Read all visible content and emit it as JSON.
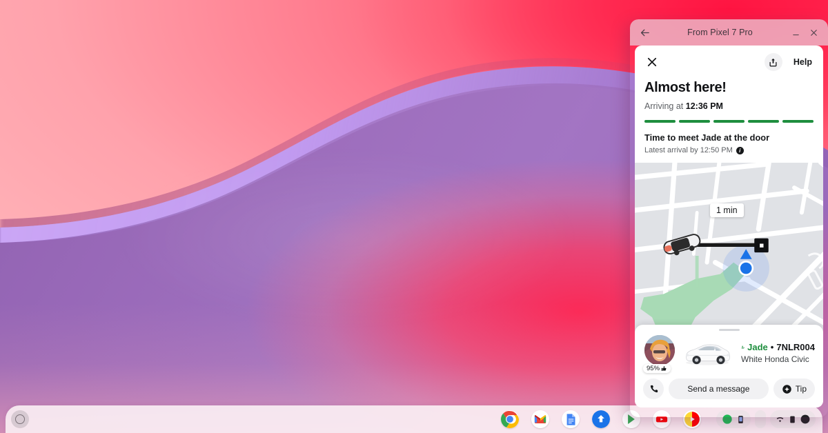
{
  "desktop": {
    "wallpaper_colors": {
      "pink_light": "#ffa9b2",
      "pink_hot": "#ff2b52",
      "purple": "#a277c9",
      "lilac": "#cdaaf8"
    },
    "shelf": {
      "launcher_name": "launcher-button",
      "apps": [
        {
          "name": "chrome",
          "label": "Chrome"
        },
        {
          "name": "gmail",
          "label": "Gmail"
        },
        {
          "name": "docs",
          "label": "Docs"
        },
        {
          "name": "files",
          "label": "Files"
        },
        {
          "name": "play-store",
          "label": "Play Store"
        },
        {
          "name": "youtube",
          "label": "YouTube"
        },
        {
          "name": "youtube-music",
          "label": "YouTube Music"
        }
      ],
      "status": {
        "time": "",
        "battery": ""
      }
    }
  },
  "window": {
    "title": "From Pixel 7 Pro",
    "back_icon": "back-arrow-icon",
    "minimize_icon": "minimize-icon",
    "close_icon": "close-icon"
  },
  "app": {
    "close_icon": "close-icon",
    "share_icon": "share-icon",
    "help_label": "Help",
    "headline": "Almost here!",
    "arriving_prefix": "Arriving at ",
    "arriving_time": "12:36 PM",
    "progress": {
      "segments": 5,
      "filled": 5,
      "color": "#1e8e3e",
      "empty_color": "#dadce0"
    },
    "meet_text": "Time to meet Jade at the door",
    "latest_arrival": "Latest arrival by 12:50 PM",
    "info_icon": "info-icon",
    "map": {
      "eta_chip": "1 min",
      "vehicle_icon": "car-marker-icon",
      "destination_icon": "destination-marker-icon",
      "user_location_icon": "user-location-dot-icon",
      "road_color": "#ffffff",
      "block_color": "#e0e2e6",
      "park_color": "#a8dab5",
      "route_color": "#1a1a1a"
    },
    "driver": {
      "avatar_name": "driver-avatar",
      "rating": "95%",
      "rating_icon": "thumbs-up-icon",
      "person_icon": "verified-person-icon",
      "name": "Jade",
      "separator": "•",
      "plate": "7NLR004",
      "vehicle": "White Honda Civic"
    },
    "actions": {
      "call_icon": "phone-icon",
      "message_label": "Send a message",
      "tip_icon": "tip-coin-icon",
      "tip_label": "Tip"
    }
  }
}
